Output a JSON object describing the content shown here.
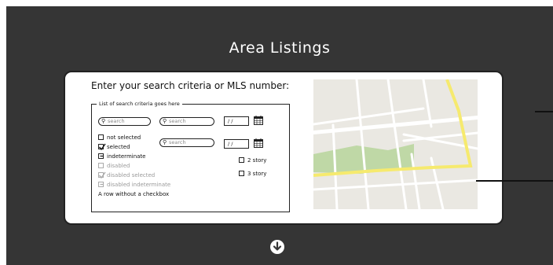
{
  "page": {
    "title": "Area Listings"
  },
  "card": {
    "heading": "Enter your search criteria or MLS number:",
    "criteria": {
      "legend": "List of search criteria goes here",
      "search_placeholders": [
        "search",
        "search",
        "search"
      ],
      "date_values": [
        "/ /",
        "/ /"
      ],
      "checkboxes": [
        {
          "label": "not selected",
          "state": "unchecked",
          "disabled": false
        },
        {
          "label": "selected",
          "state": "checked",
          "disabled": false
        },
        {
          "label": "indeterminate",
          "state": "indeterminate",
          "disabled": false
        },
        {
          "label": "disabled",
          "state": "unchecked",
          "disabled": true
        },
        {
          "label": "disabled selected",
          "state": "checked",
          "disabled": true
        },
        {
          "label": "disabled indeterminate",
          "state": "indeterminate",
          "disabled": true
        }
      ],
      "plain_row": "A row without a checkbox",
      "story_options": [
        {
          "label": "2 story",
          "state": "unchecked"
        },
        {
          "label": "3 story",
          "state": "unchecked"
        }
      ]
    }
  },
  "icons": {
    "search": "magnifier-icon",
    "calendar": "calendar-icon",
    "scroll": "arrow-down-circle-icon"
  },
  "colors": {
    "background": "#353535",
    "map_road": "#ffffff",
    "map_highway": "#f6ea6e",
    "map_park": "#bfd8a6"
  }
}
